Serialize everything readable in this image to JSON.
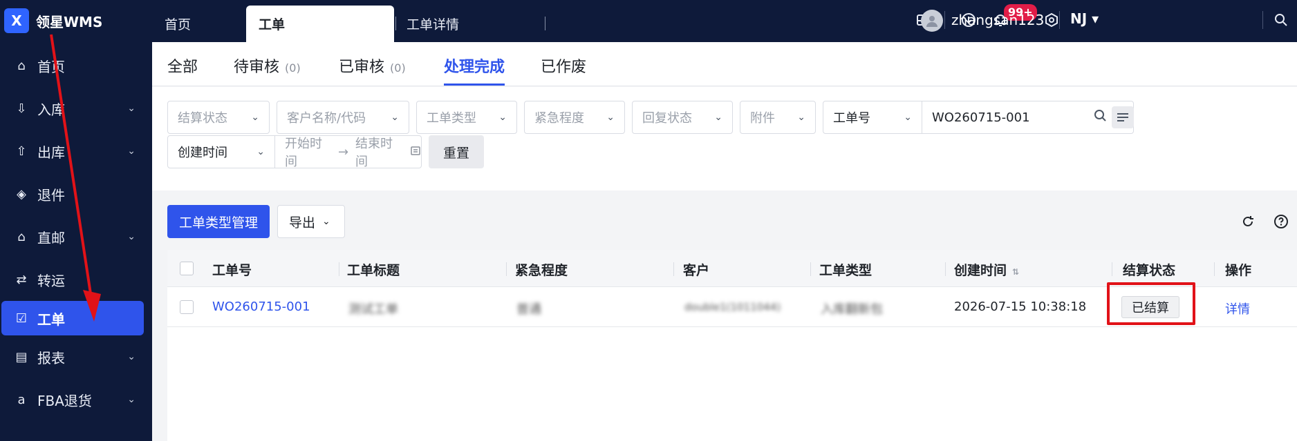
{
  "brand": {
    "logo": "X",
    "name": "领星WMS"
  },
  "sidebar": {
    "items": [
      {
        "label": "首页",
        "icon": "home-icon",
        "glyph": "⌂",
        "has_children": false,
        "active": false
      },
      {
        "label": "入库",
        "icon": "inbound-icon",
        "glyph": "⇩",
        "has_children": true,
        "active": false
      },
      {
        "label": "出库",
        "icon": "outbound-icon",
        "glyph": "⇧",
        "has_children": true,
        "active": false
      },
      {
        "label": "退件",
        "icon": "return-icon",
        "glyph": "◈",
        "has_children": false,
        "active": false
      },
      {
        "label": "直邮",
        "icon": "direct-mail-icon",
        "glyph": "⌂",
        "has_children": true,
        "active": false
      },
      {
        "label": "转运",
        "icon": "transfer-icon",
        "glyph": "⇄",
        "has_children": false,
        "active": false
      },
      {
        "label": "工单",
        "icon": "work-order-icon",
        "glyph": "☑",
        "has_children": false,
        "active": true
      },
      {
        "label": "报表",
        "icon": "report-icon",
        "glyph": "▤",
        "has_children": true,
        "active": false
      },
      {
        "label": "FBA退货",
        "icon": "amazon-icon",
        "glyph": "a",
        "has_children": true,
        "active": false
      }
    ],
    "chevron": "⌄"
  },
  "topbar": {
    "tabs": [
      {
        "label": "首页",
        "active": false
      },
      {
        "label": "工单",
        "active": true
      },
      {
        "label": "工单详情",
        "active": false
      }
    ],
    "notification_badge": "99+",
    "username": "zhangsan123",
    "warehouse": "NJ ▾"
  },
  "subtabs": {
    "all": "全部",
    "pending": "待审核",
    "pending_count": "(0)",
    "reviewed": "已审核",
    "reviewed_count": "(0)",
    "done": "处理完成",
    "void": "已作废"
  },
  "filters": {
    "settlement_status": "结算状态",
    "customer": "客户名称/代码",
    "order_type": "工单类型",
    "urgency": "紧急程度",
    "reply_status": "回复状态",
    "attachment": "附件",
    "search_field": "工单号",
    "search_value": "WO260715-001",
    "time_field": "创建时间",
    "start_time": "开始时间",
    "end_time": "结束时间",
    "reset": "重置"
  },
  "toolbar": {
    "manage_types": "工单类型管理",
    "export": "导出"
  },
  "table": {
    "columns": [
      "工单号",
      "工单标题",
      "紧急程度",
      "客户",
      "工单类型",
      "创建时间",
      "结算状态",
      "操作"
    ],
    "rows": [
      {
        "order_no": "WO260715-001",
        "title": "测试工单",
        "urgency": "普通",
        "customer": "double1(1011044)",
        "type": "入库翻新包",
        "created": "2026-07-15 10:38:18",
        "settlement": "已结算",
        "action": "详情"
      }
    ]
  },
  "colors": {
    "sidebar_bg": "#0e1a3a",
    "accent": "#2f54eb",
    "highlight": "#e11218"
  }
}
